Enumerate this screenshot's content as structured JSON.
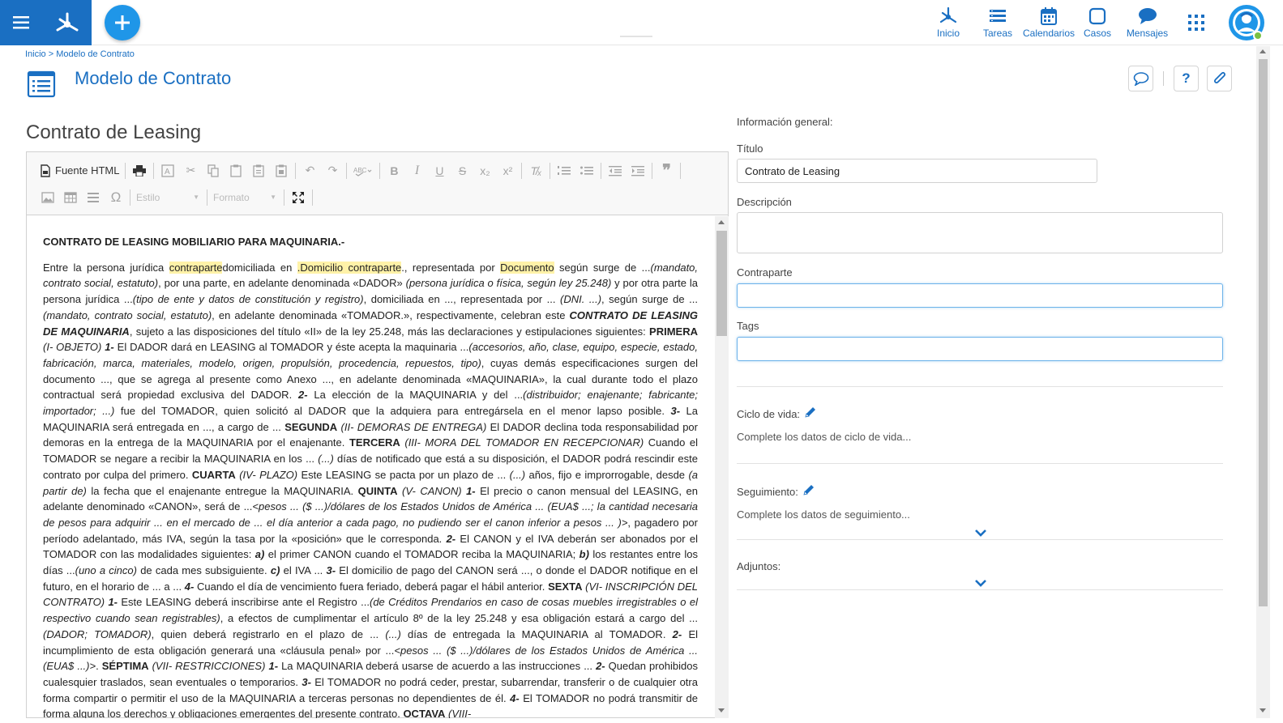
{
  "nav": {
    "items": [
      {
        "label": "Inicio"
      },
      {
        "label": "Tareas"
      },
      {
        "label": "Calendarios"
      },
      {
        "label": "Casos"
      },
      {
        "label": "Mensajes"
      }
    ]
  },
  "breadcrumb": {
    "home": "Inicio",
    "sep": ">",
    "current": "Modelo de Contrato"
  },
  "page": {
    "title": "Modelo de Contrato",
    "help": "?"
  },
  "doc": {
    "title": "Contrato de Leasing"
  },
  "editor": {
    "source_label": "Fuente HTML",
    "style_label": "Estilo",
    "format_label": "Formato",
    "heading": "CONTRATO DE LEASING MOBILIARIO PARA MAQUINARIA.-",
    "p1_a": "Entre la persona jurídica ",
    "p1_hl1": "contraparte",
    "p1_b": "domiciliada en ",
    "p1_hl2": ".Domicilio contraparte",
    "p1_c": "., representada por ",
    "p1_hl3": "Documento",
    "p1_d": " según surge de ...",
    "p1_e": "(mandato, contrato social, estatuto)",
    "p1_f": ", por una parte, en adelante denominada «DADOR» ",
    "p1_g": "(persona jurídica o física, según ley 25.248)",
    "p1_h": " y por otra parte la persona jurídica ...",
    "p1_i": "(tipo de ente y datos de constitución y registro)",
    "p1_j": ", domiciliada en ..., representada por ... ",
    "p1_k": "(DNI. ...)",
    "p1_l": ", según surge de ... ",
    "p1_m": "(mandato, contrato social, estatuto)",
    "p1_n": ", en adelante denominada «TOMADOR.», respectivamente, celebran este ",
    "p1_o": "CONTRATO DE LEASING DE MAQUINARIA",
    "p1_p": ", sujeto a las disposiciones del título «II» de la ley 25.248, más las declaraciones y estipulaciones siguientes: ",
    "p1_q": "PRIMERA",
    "p1_r": " (I- OBJETO) ",
    "p1_s": "1-",
    "p1_t": " El DADOR dará en LEASING al TOMADOR y éste acepta la maquinaria ...",
    "p1_u": "(accesorios, año, clase, equipo, especie, estado, fabricación, marca, materiales, modelo, origen, propulsión, procedencia, repuestos, tipo)",
    "p1_v": ", cuyas demás especificaciones surgen del documento ..., que se agrega al presente como Anexo ..., en adelante denominada «MAQUINARIA», la cual durante todo el plazo contractual será propiedad exclusiva del DADOR. ",
    "p1_w": "2-",
    "p1_x": " La elección de la MAQUINARIA y del ...",
    "p1_y": "(distribuidor; enajenante; fabricante; importador; ...)",
    "p1_z": " fue del TOMADOR, quien solicitó al DADOR que la adquiera para entregársela en el menor lapso posible. ",
    "p2_a": "3-",
    "p2_b": " La MAQUINARIA será entregada en ..., a cargo de ... ",
    "p2_c": "SEGUNDA",
    "p2_d": " (II- DEMORAS DE ENTREGA)",
    "p2_e": " El DADOR declina toda responsabilidad por demoras en la entrega de la MAQUINARIA por el enajenante. ",
    "p2_f": "TERCERA",
    "p2_g": " (III- MORA DEL TOMADOR EN RECEPCIONAR)",
    "p2_h": " Cuando el TOMADOR se negare a recibir la MAQUINARIA en los ... ",
    "p2_i": "(...)",
    "p2_j": " días de notificado que está a su disposición, el DADOR podrá rescindir este contrato por culpa del primero. ",
    "p2_k": "CUARTA",
    "p2_l": " (IV- PLAZO)",
    "p2_m": " Este LEASING se pacta por un plazo de ... ",
    "p2_n": "(...)",
    "p2_o": " años, fijo e improrrogable, desde ",
    "p2_p": "(a partir de)",
    "p2_q": " la fecha que el enajenante entregue la MAQUINARIA. ",
    "p2_r": "QUINTA",
    "p2_s": " (V- CANON) ",
    "p2_t": "1-",
    "p2_u": " El precio o canon mensual del LEASING, en adelante denominado «CANON», será de ...",
    "p2_v": "<pesos ... ($ ...)/dólares de los Estados Unidos de América ... (EUA$ ...; la cantidad necesaria de pesos para adquirir ... en el mercado de ... el día anterior a cada pago, no pudiendo ser el canon inferior a pesos ... )>",
    "p2_w": ", pagadero por período adelantado, más IVA, según la tasa por la «posición» que le corresponda. ",
    "p2_x": "2-",
    "p2_y": " El CANON y el IVA deberán ser abonados por el TOMADOR con las modalidades siguientes: ",
    "p2_z": "a)",
    "p3_a": " el primer CANON cuando el TOMADOR reciba la MAQUINARIA; ",
    "p3_b": "b)",
    "p3_c": " los restantes entre los días ...",
    "p3_d": "(uno a cinco)",
    "p3_e": " de cada mes subsiguiente. ",
    "p3_f": "c)",
    "p3_g": " el IVA ... ",
    "p3_h": "3-",
    "p3_i": " El domicilio de pago del CANON será ..., o donde el DADOR notifique en el futuro, en el horario de ... a ... ",
    "p3_j": "4-",
    "p3_k": " Cuando el día de vencimiento fuera feriado, deberá pagar el hábil anterior. ",
    "p3_l": "SEXTA",
    "p3_m": " (VI- INSCRIPCIÓN DEL CONTRATO) ",
    "p3_n": "1-",
    "p3_o": " Este LEASING deberá inscribirse ante el Registro ...",
    "p3_p": "(de Créditos Prendarios en caso de cosas muebles irregistrables o el respectivo cuando sean registrables)",
    "p3_q": ", a efectos de cumplimentar el artículo 8º de la ley 25.248 y esa obligación estará a cargo del ...",
    "p3_r": "(DADOR; TOMADOR)",
    "p3_s": ", quien deberá registrarlo en el plazo de ... ",
    "p3_t": "(...)",
    "p3_u": " días de entregada la MAQUINARIA al TOMADOR. ",
    "p3_v": "2-",
    "p3_w": " El incumplimiento de esta obligación generará una «cláusula penal» por ...",
    "p3_x": "<pesos ... ($ ...)/dólares de los Estados Unidos de América ... (EUA$ ...)>",
    "p3_y": ". ",
    "p3_z": "SÉPTIMA",
    "p4_a": " (VII- RESTRICCIONES) ",
    "p4_b": "1-",
    "p4_c": " La MAQUINARIA deberá usarse de acuerdo a las instrucciones ... ",
    "p4_d": "2-",
    "p4_e": " Quedan prohibidos cualesquier traslados, sean eventuales o temporarios. ",
    "p4_f": "3-",
    "p4_g": " El TOMADOR no podrá ceder, prestar, subarrendar, transferir o de cualquier otra forma compartir o permitir el uso de la MAQUINARIA a terceras personas no dependientes de él. ",
    "p4_h": "4-",
    "p4_i": " El TOMADOR no podrá transmitir de forma alguna los derechos y obligaciones emergentes del presente contrato. ",
    "p4_j": "OCTAVA",
    "p4_k": " (VIII-"
  },
  "form": {
    "general_label": "Información general:",
    "title_label": "Título",
    "title_value": "Contrato de Leasing",
    "description_label": "Descripción",
    "description_value": "",
    "counterpart_label": "Contraparte",
    "counterpart_value": "",
    "tags_label": "Tags",
    "tags_value": "",
    "lifecycle_label": "Ciclo de vida:",
    "lifecycle_hint": "Complete los datos de ciclo de vida...",
    "tracking_label": "Seguimiento:",
    "tracking_hint": "Complete los datos de seguimiento...",
    "attachments_label": "Adjuntos:"
  },
  "colors": {
    "brand": "#1a6fc2",
    "accent": "#1f96e8",
    "highlight": "#fff2a8",
    "online": "#7ac143"
  }
}
